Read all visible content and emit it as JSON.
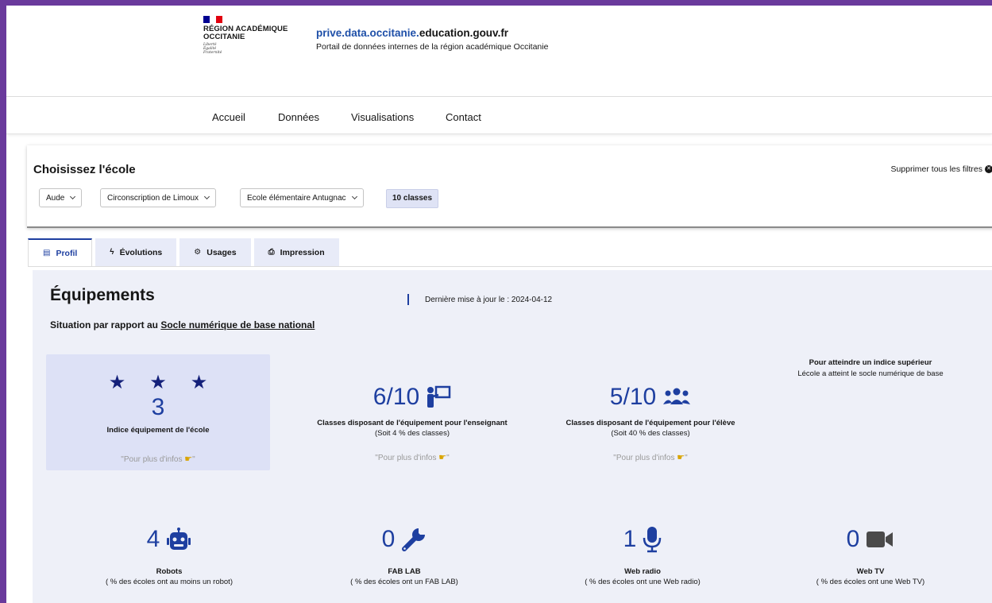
{
  "header": {
    "logo_line1": "RÉGION ACADÉMIQUE",
    "logo_line2": "OCCITANIE",
    "motto": [
      "Liberté",
      "Égalité",
      "Fraternité"
    ],
    "site_title_accent": "prive.data.occitanie.",
    "site_title_rest": "education.gouv.fr",
    "site_subtitle": "Portail de données internes de la région académique Occitanie"
  },
  "nav": {
    "items": [
      {
        "label": "Accueil"
      },
      {
        "label": "Données"
      },
      {
        "label": "Visualisations"
      },
      {
        "label": "Contact"
      }
    ]
  },
  "filters": {
    "title": "Choisissez l'école",
    "clear_label": "Supprimer tous les filtres",
    "department": "Aude",
    "circonscription": "Circonscription de Limoux",
    "school": "Ecole élémentaire Antugnac",
    "classes_badge": "10 classes"
  },
  "tabs": [
    {
      "label": "Profil",
      "icon": "id-card-icon",
      "glyph": "▤",
      "active": true
    },
    {
      "label": "Évolutions",
      "icon": "bolt-icon",
      "glyph": "ϟ",
      "active": false
    },
    {
      "label": "Usages",
      "icon": "cogs-icon",
      "glyph": "⚙",
      "active": false
    },
    {
      "label": "Impression",
      "icon": "printer-icon",
      "glyph": "⎙",
      "active": false
    }
  ],
  "equipements": {
    "title": "Équipements",
    "last_update": "Dernière mise à jour le : 2024-04-12",
    "situation_prefix": "Situation par rapport au ",
    "situation_link": "Socle numérique de base national",
    "index": {
      "stars": 3,
      "value": "3",
      "label": "Indice équipement de l'école",
      "infos": "\"Pour plus d'infos"
    },
    "teacher": {
      "value": "6/10",
      "icon": "teacher-board-icon",
      "label": "Classes disposant de l'équipement pour l'enseignant",
      "sub": "(Soit 4 % des classes)",
      "infos": "\"Pour plus d'infos"
    },
    "student": {
      "value": "5/10",
      "icon": "users-icon",
      "label": "Classes disposant de l'équipement pour l'élève",
      "sub": "(Soit 40 % des classes)",
      "infos": "\"Pour plus d'infos"
    },
    "reach": {
      "title": "Pour atteindre un indice supérieur",
      "text": "Lécole a atteint le socle numérique de base"
    },
    "bottom": [
      {
        "value": "4",
        "icon": "robot-icon",
        "label": "Robots",
        "sub": "( % des écoles ont au moins un robot)"
      },
      {
        "value": "0",
        "icon": "wrench-icon",
        "label": "FAB LAB",
        "sub": "( % des écoles ont un FAB LAB)"
      },
      {
        "value": "1",
        "icon": "microphone-icon",
        "label": "Web radio",
        "sub": "( % des écoles ont une Web radio)"
      },
      {
        "value": "0",
        "icon": "video-camera-icon",
        "label": "Web TV",
        "sub": "( % des écoles ont une Web TV)"
      }
    ]
  },
  "colors": {
    "frame": "#6a3a9c",
    "accent": "#1e3fa0",
    "panel": "#eef0f8",
    "index_card": "#dde1f6"
  }
}
